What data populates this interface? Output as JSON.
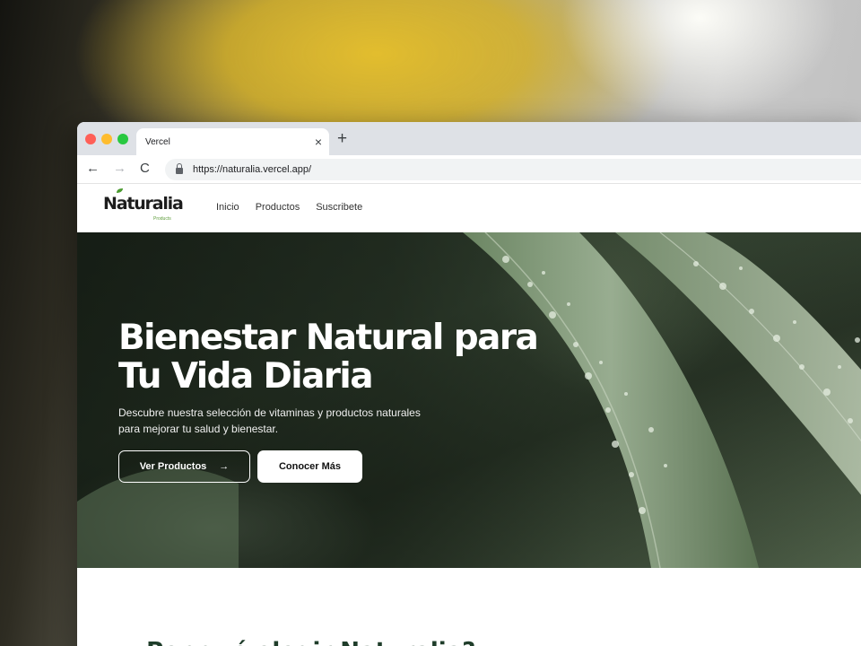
{
  "browser": {
    "tab_title": "Vercel",
    "tab_close": "×",
    "new_tab": "+",
    "url": "https://naturalia.vercel.app/",
    "back": "←",
    "forward": "→",
    "reload": "C"
  },
  "site": {
    "logo": "Naturalia",
    "logo_sub": "Products",
    "nav": [
      "Inicio",
      "Productos",
      "Suscribete"
    ]
  },
  "hero": {
    "title": "Bienestar Natural para Tu Vida Diaria",
    "subtitle": "Descubre nuestra selección de vitaminas y productos naturales para mejorar tu salud y bienestar.",
    "primary_button": "Ver Productos",
    "primary_arrow": "→",
    "secondary_button": "Conocer Más"
  },
  "next_section": {
    "title": "¿Por qué elegir Naturalia?"
  },
  "colors": {
    "brand_green": "#5d9c3a",
    "heading_dark_green": "#1f3d2a"
  }
}
